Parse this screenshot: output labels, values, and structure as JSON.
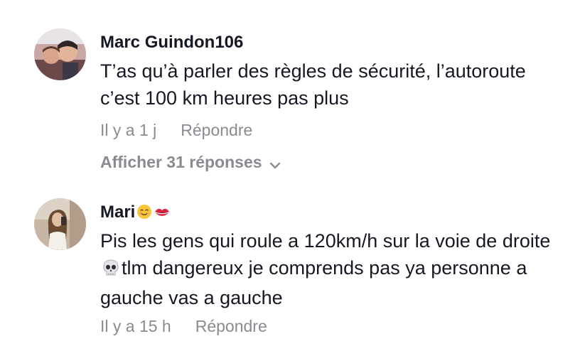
{
  "comments": [
    {
      "username": "Marc Guindon106",
      "text": "T’as qu’à parler des règles de sécurité, l’autoroute c’est 100 km heures pas plus",
      "time": "Il y a 1 j",
      "reply_label": "Répondre",
      "view_replies_label": "Afficher 31 réponses"
    },
    {
      "username": "Mari",
      "username_emojis": [
        "smiling-face-emoji",
        "kiss-mark-emoji"
      ],
      "text_part1": "Pis les gens qui roule a 120km/h sur la voie de droite",
      "text_emoji": "skull-emoji",
      "text_part2": "tlm dangereux je comprends pas ya personne a gauche vas a gauche",
      "time": "Il y a 15 h",
      "reply_label": "Répondre"
    }
  ],
  "colors": {
    "text_primary": "#161823",
    "text_secondary": "#8a8b91",
    "background": "#ffffff"
  }
}
